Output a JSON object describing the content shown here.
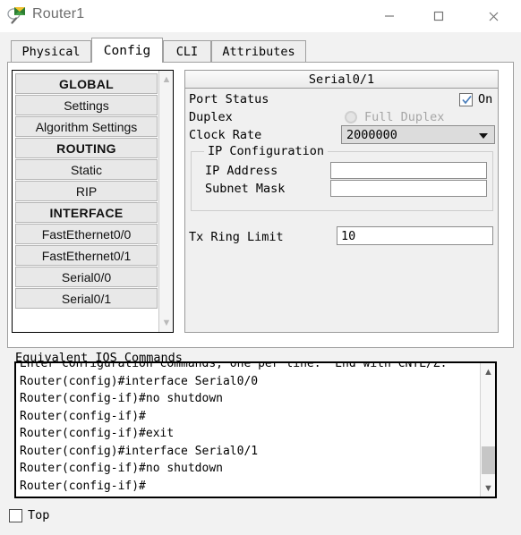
{
  "window": {
    "title": "Router1",
    "icon": "router-device-icon",
    "controls": {
      "minimize": "minimize-icon",
      "maximize": "maximize-icon",
      "close": "close-icon"
    }
  },
  "tabs": [
    {
      "label": "Physical",
      "active": false
    },
    {
      "label": "Config",
      "active": true
    },
    {
      "label": "CLI",
      "active": false
    },
    {
      "label": "Attributes",
      "active": false
    }
  ],
  "sidebar": {
    "items": [
      {
        "label": "GLOBAL",
        "type": "header"
      },
      {
        "label": "Settings",
        "type": "item"
      },
      {
        "label": "Algorithm Settings",
        "type": "item"
      },
      {
        "label": "ROUTING",
        "type": "header"
      },
      {
        "label": "Static",
        "type": "item"
      },
      {
        "label": "RIP",
        "type": "item"
      },
      {
        "label": "INTERFACE",
        "type": "header"
      },
      {
        "label": "FastEthernet0/0",
        "type": "item"
      },
      {
        "label": "FastEthernet0/1",
        "type": "item"
      },
      {
        "label": "Serial0/0",
        "type": "item"
      },
      {
        "label": "Serial0/1",
        "type": "item"
      }
    ],
    "scroll_up": "chevron-up-icon",
    "scroll_down": "chevron-down-icon"
  },
  "config_panel": {
    "title": "Serial0/1",
    "port_status": {
      "label": "Port Status",
      "state_label": "On",
      "checked": true
    },
    "duplex": {
      "label": "Duplex",
      "option_label": "Full Duplex",
      "selected": true,
      "disabled": true
    },
    "clock_rate": {
      "label": "Clock Rate",
      "value": "2000000"
    },
    "ip_configuration": {
      "legend": "IP Configuration",
      "ip_address": {
        "label": "IP Address",
        "value": ""
      },
      "subnet_mask": {
        "label": "Subnet Mask",
        "value": ""
      }
    },
    "tx_ring_limit": {
      "label": "Tx Ring Limit",
      "value": "10"
    }
  },
  "ios": {
    "heading": "Equivalent IOS Commands",
    "lines": [
      "Enter configuration commands, one per line.  End with CNTL/Z.",
      "Router(config)#interface Serial0/0",
      "Router(config-if)#no shutdown",
      "Router(config-if)#",
      "Router(config-if)#exit",
      "Router(config)#interface Serial0/1",
      "Router(config-if)#no shutdown",
      "Router(config-if)#"
    ],
    "scroll_up": "chevron-up-icon",
    "scroll_down": "chevron-down-icon"
  },
  "footer": {
    "top_checkbox": {
      "label": "Top",
      "checked": false
    }
  },
  "colors": {
    "title_text": "#6d6d6d",
    "check_blue": "#4a7ebb",
    "panel_bg": "#f0f0f0",
    "sidebar_item": "#e8e8e8"
  }
}
